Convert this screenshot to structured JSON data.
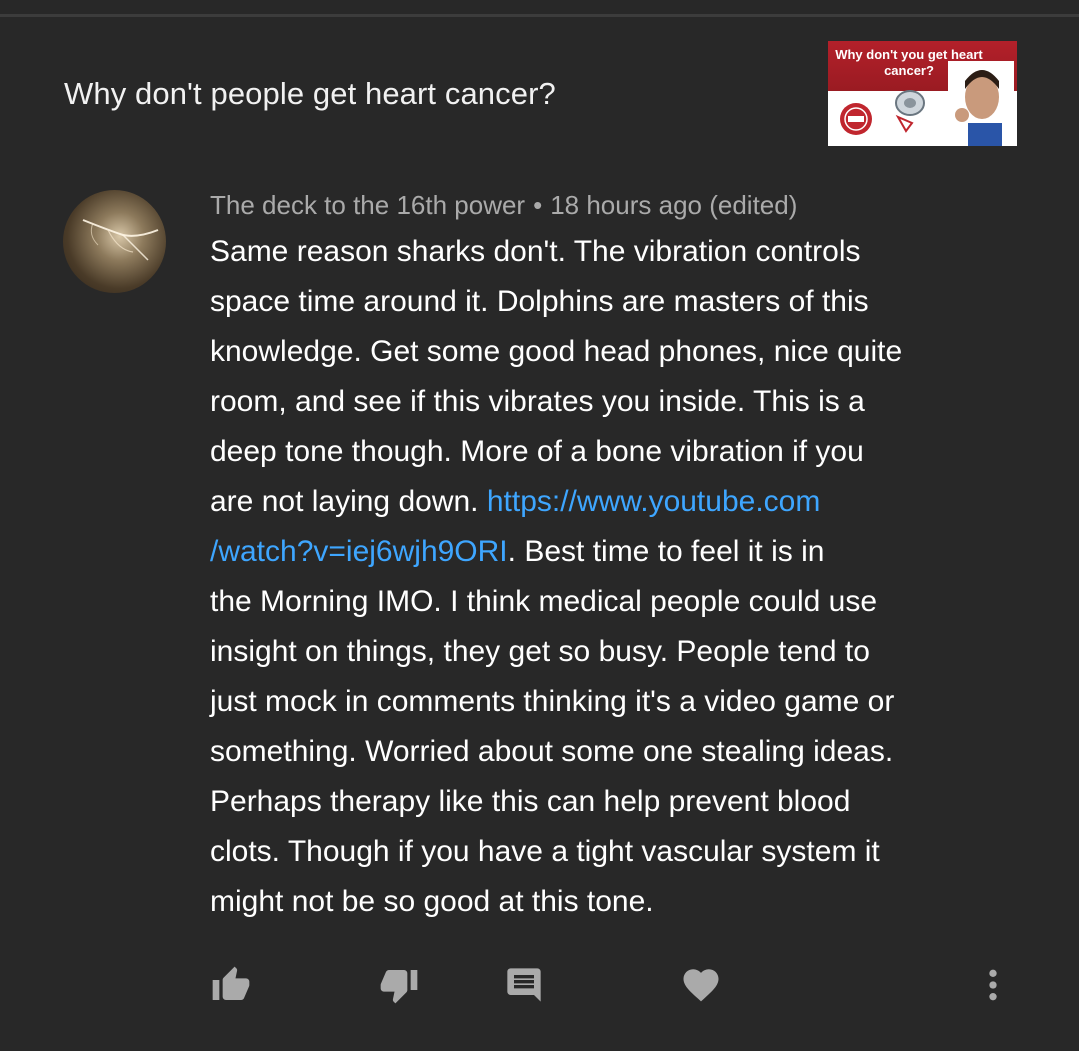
{
  "video": {
    "title": "Why don't people get heart cancer?",
    "thumbnail_text": "Why don't you get heart cancer?"
  },
  "comment": {
    "author": "The deck to the 16th power",
    "separator": "•",
    "time": "18 hours ago (edited)",
    "text_part1": "Same reason sharks don't. The vibration controls\nspace time around it. Dolphins are masters of this\nknowledge. Get some good head phones, nice quite\nroom, and see if this vibrates you inside. This is a\ndeep tone though. More of a bone vibration if you\nare not laying down.  ",
    "link_part1": "https://www.youtube.com",
    "link_part2": "/watch?v=iej6wjh9ORI",
    "text_part2": ".   Best time to feel it is in\nthe Morning IMO.  I think medical people could use\ninsight on things, they get so busy. People tend to\njust mock in comments thinking it's a video game or\nsomething. Worried about some one stealing ideas.\nPerhaps therapy like this can help prevent blood\nclots. Though if you have a tight vascular system it\nmight not be so good at this tone."
  },
  "actions": {
    "like_icon": "thumbs-up-icon",
    "dislike_icon": "thumbs-down-icon",
    "reply_icon": "comment-icon",
    "heart_icon": "heart-icon",
    "more_icon": "more-vertical-icon"
  },
  "colors": {
    "background": "#282828",
    "link": "#3ea6ff",
    "meta": "#aaaaaa",
    "icon": "#aaaaaa"
  }
}
